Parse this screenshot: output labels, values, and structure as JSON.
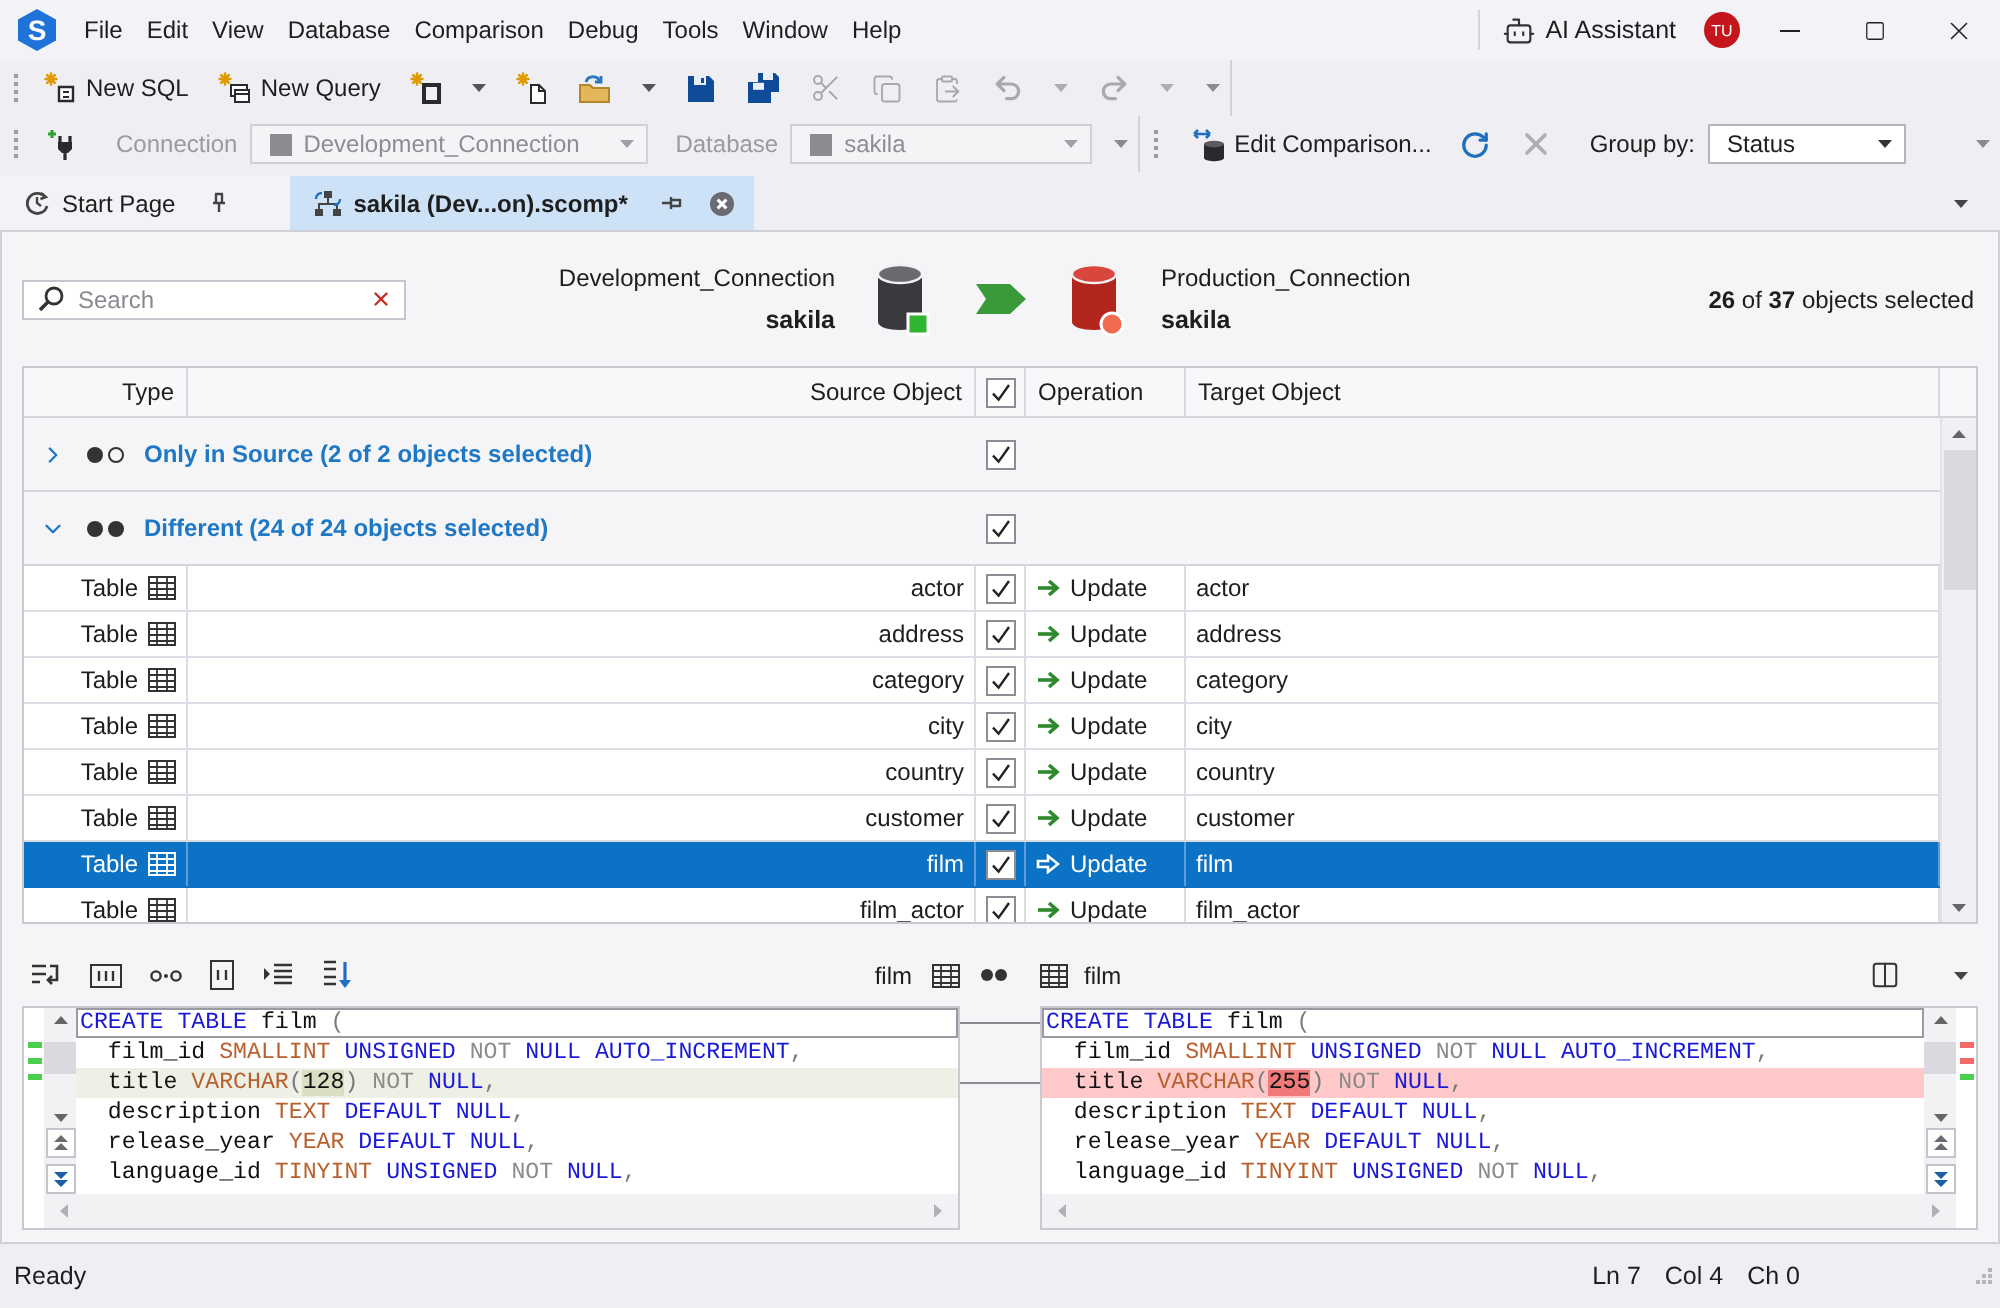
{
  "app": {
    "logo": "S",
    "menu": [
      "File",
      "Edit",
      "View",
      "Database",
      "Comparison",
      "Debug",
      "Tools",
      "Window",
      "Help"
    ],
    "assistant": "AI Assistant",
    "avatar": "TU"
  },
  "toolbar": [
    {
      "kind": "new_sql",
      "label": "New SQL",
      "dropdown": false,
      "disabled": false
    },
    {
      "kind": "new_query",
      "label": "New Query",
      "dropdown": false,
      "disabled": false
    },
    {
      "kind": "new_frame",
      "dropdown": true,
      "disabled": false
    },
    {
      "kind": "new_page",
      "dropdown": false,
      "disabled": false
    },
    {
      "kind": "open",
      "dropdown": true,
      "disabled": false
    },
    {
      "kind": "save",
      "dropdown": false,
      "disabled": false
    },
    {
      "kind": "save_all",
      "dropdown": false,
      "disabled": false
    },
    {
      "kind": "cut",
      "dropdown": false,
      "disabled": true
    },
    {
      "kind": "copy",
      "dropdown": false,
      "disabled": true
    },
    {
      "kind": "paste",
      "dropdown": false,
      "disabled": true
    },
    {
      "kind": "undo",
      "dropdown": true,
      "disabled": true
    },
    {
      "kind": "redo",
      "dropdown": true,
      "disabled": true
    }
  ],
  "connection_bar": {
    "connection": {
      "label": "Connection",
      "value": "Development_Connection",
      "disabled": true
    },
    "database": {
      "label": "Database",
      "value": "sakila",
      "disabled": true
    }
  },
  "comparison_bar": {
    "actions": [
      {
        "kind": "edit",
        "label": "Edit Comparison...",
        "disabled": false
      },
      {
        "kind": "refresh",
        "disabled": false
      },
      {
        "kind": "stop",
        "disabled": true
      }
    ],
    "group_by": {
      "label": "Group by:",
      "value": "Status"
    }
  },
  "tabs": [
    {
      "kind": "start",
      "label": "Start Page",
      "selected": false,
      "pinned": true
    },
    {
      "kind": "comparison",
      "label": "sakila (Dev...on).scomp*",
      "selected": true,
      "pinned": false
    }
  ],
  "header": {
    "search": {
      "placeholder": "Search"
    },
    "source": {
      "connection": "Development_Connection",
      "database": "sakila"
    },
    "target": {
      "connection": "Production_Connection",
      "database": "sakila"
    },
    "summary": "**26** of **37** objects selected"
  },
  "grid": {
    "columns": {
      "type": "Type",
      "source": "Source Object",
      "operation": "Operation",
      "target": "Target Object"
    },
    "all_checked": true,
    "groups": [
      {
        "kind": "source_only",
        "label": "Only in Source (2 of 2 objects selected)",
        "expanded": false,
        "checked": true
      },
      {
        "kind": "different",
        "label": "Different (24 of 24 objects selected)",
        "expanded": true,
        "checked": true,
        "rows": [
          {
            "type": "Table",
            "source": "actor",
            "checked": true,
            "operation": "Update",
            "target": "actor",
            "selected": false
          },
          {
            "type": "Table",
            "source": "address",
            "checked": true,
            "operation": "Update",
            "target": "address",
            "selected": false
          },
          {
            "type": "Table",
            "source": "category",
            "checked": true,
            "operation": "Update",
            "target": "category",
            "selected": false
          },
          {
            "type": "Table",
            "source": "city",
            "checked": true,
            "operation": "Update",
            "target": "city",
            "selected": false
          },
          {
            "type": "Table",
            "source": "country",
            "checked": true,
            "operation": "Update",
            "target": "country",
            "selected": false
          },
          {
            "type": "Table",
            "source": "customer",
            "checked": true,
            "operation": "Update",
            "target": "customer",
            "selected": false
          },
          {
            "type": "Table",
            "source": "film",
            "checked": true,
            "operation": "Update",
            "target": "film",
            "selected": true
          },
          {
            "type": "Table",
            "source": "film_actor",
            "checked": true,
            "operation": "Update",
            "target": "film_actor",
            "selected": false
          }
        ]
      }
    ]
  },
  "compare": {
    "source_name": "film",
    "target_name": "film",
    "panes": [
      {
        "kind": "source",
        "markers": [
          {
            "color": "#4ccf4c"
          },
          {
            "color": "#4ccf4c"
          },
          {
            "color": "#4ccf4c"
          }
        ],
        "lines": [
          {
            "current": true,
            "changed": false,
            "tokens": [
              {
                "kind": "keyword",
                "text": "CREATE TABLE"
              },
              {
                "kind": "plain",
                "text": " film "
              },
              {
                "kind": "punct",
                "text": "("
              }
            ]
          },
          {
            "current": false,
            "changed": false,
            "tokens": [
              {
                "kind": "plain",
                "text": "  film_id "
              },
              {
                "kind": "type",
                "text": "SMALLINT"
              },
              {
                "kind": "keyword",
                "text": " UNSIGNED"
              },
              {
                "kind": "operator",
                "text": " NOT"
              },
              {
                "kind": "keyword",
                "text": " NULL AUTO_INCREMENT"
              },
              {
                "kind": "punct",
                "text": ","
              }
            ]
          },
          {
            "current": false,
            "changed": true,
            "tokens": [
              {
                "kind": "plain",
                "text": "  title "
              },
              {
                "kind": "type",
                "text": "VARCHAR"
              },
              {
                "kind": "punct",
                "text": "("
              },
              {
                "kind": "diff",
                "text": "128"
              },
              {
                "kind": "punct",
                "text": ")"
              },
              {
                "kind": "operator",
                "text": " NOT"
              },
              {
                "kind": "keyword",
                "text": " NULL"
              },
              {
                "kind": "punct",
                "text": ","
              }
            ]
          },
          {
            "current": false,
            "changed": false,
            "tokens": [
              {
                "kind": "plain",
                "text": "  description "
              },
              {
                "kind": "type",
                "text": "TEXT"
              },
              {
                "kind": "keyword",
                "text": " DEFAULT NULL"
              },
              {
                "kind": "punct",
                "text": ","
              }
            ]
          },
          {
            "current": false,
            "changed": false,
            "tokens": [
              {
                "kind": "plain",
                "text": "  release_year "
              },
              {
                "kind": "type",
                "text": "YEAR"
              },
              {
                "kind": "keyword",
                "text": " DEFAULT NULL"
              },
              {
                "kind": "punct",
                "text": ","
              }
            ]
          },
          {
            "current": false,
            "changed": false,
            "tokens": [
              {
                "kind": "plain",
                "text": "  language_id "
              },
              {
                "kind": "type",
                "text": "TINYINT"
              },
              {
                "kind": "keyword",
                "text": " UNSIGNED"
              },
              {
                "kind": "operator",
                "text": " NOT"
              },
              {
                "kind": "keyword",
                "text": " NULL"
              },
              {
                "kind": "punct",
                "text": ","
              }
            ]
          }
        ]
      },
      {
        "kind": "target",
        "markers": [
          {
            "color": "#f26a6a"
          },
          {
            "color": "#f26a6a"
          },
          {
            "color": "#4ccf4c"
          }
        ],
        "lines": [
          {
            "current": true,
            "changed": false,
            "tokens": [
              {
                "kind": "keyword",
                "text": "CREATE TABLE"
              },
              {
                "kind": "plain",
                "text": " film "
              },
              {
                "kind": "punct",
                "text": "("
              }
            ]
          },
          {
            "current": false,
            "changed": false,
            "tokens": [
              {
                "kind": "plain",
                "text": "  film_id "
              },
              {
                "kind": "type",
                "text": "SMALLINT"
              },
              {
                "kind": "keyword",
                "text": " UNSIGNED"
              },
              {
                "kind": "operator",
                "text": " NOT"
              },
              {
                "kind": "keyword",
                "text": " NULL AUTO_INCREMENT"
              },
              {
                "kind": "punct",
                "text": ","
              }
            ]
          },
          {
            "current": false,
            "changed": true,
            "tokens": [
              {
                "kind": "plain",
                "text": "  title "
              },
              {
                "kind": "type",
                "text": "VARCHAR"
              },
              {
                "kind": "punct",
                "text": "("
              },
              {
                "kind": "diff",
                "text": "255"
              },
              {
                "kind": "punct",
                "text": ")"
              },
              {
                "kind": "operator",
                "text": " NOT"
              },
              {
                "kind": "keyword",
                "text": " NULL"
              },
              {
                "kind": "punct",
                "text": ","
              }
            ]
          },
          {
            "current": false,
            "changed": false,
            "tokens": [
              {
                "kind": "plain",
                "text": "  description "
              },
              {
                "kind": "type",
                "text": "TEXT"
              },
              {
                "kind": "keyword",
                "text": " DEFAULT NULL"
              },
              {
                "kind": "punct",
                "text": ","
              }
            ]
          },
          {
            "current": false,
            "changed": false,
            "tokens": [
              {
                "kind": "plain",
                "text": "  release_year "
              },
              {
                "kind": "type",
                "text": "YEAR"
              },
              {
                "kind": "keyword",
                "text": " DEFAULT NULL"
              },
              {
                "kind": "punct",
                "text": ","
              }
            ]
          },
          {
            "current": false,
            "changed": false,
            "tokens": [
              {
                "kind": "plain",
                "text": "  language_id "
              },
              {
                "kind": "type",
                "text": "TINYINT"
              },
              {
                "kind": "keyword",
                "text": " UNSIGNED"
              },
              {
                "kind": "operator",
                "text": " NOT"
              },
              {
                "kind": "keyword",
                "text": " NULL"
              },
              {
                "kind": "punct",
                "text": ","
              }
            ]
          }
        ]
      }
    ]
  },
  "status_bar": {
    "message": "Ready",
    "line": "Ln 7",
    "column": "Col 4",
    "char": "Ch 0"
  }
}
